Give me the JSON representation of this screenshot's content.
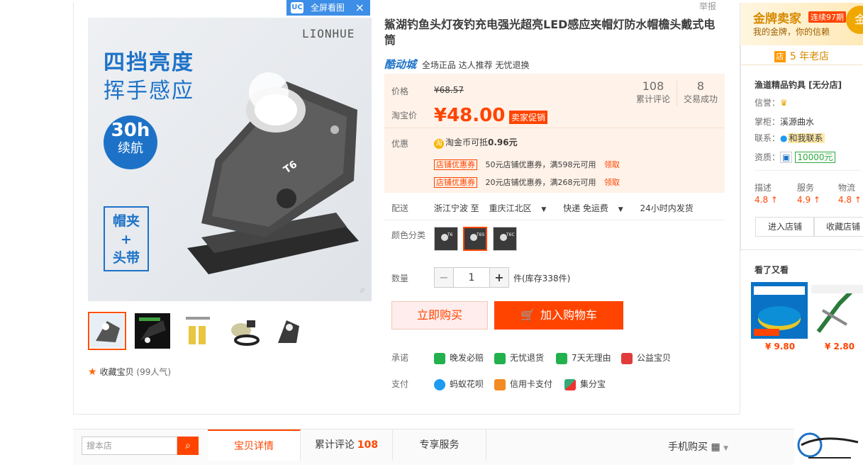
{
  "report_link": "举报",
  "fullscreen_tag": {
    "icon_text": "UC",
    "label": "全屏看图"
  },
  "gallery": {
    "brand": "LIONHUE",
    "headline1": "四挡亮度",
    "headline2": "挥手感应",
    "battery_big": "30h",
    "battery_small": "续航",
    "clip_text1": "帽夹",
    "clip_text2": "+",
    "clip_text3": "头带",
    "lamp_label": "T6"
  },
  "thumbnails_count": 5,
  "favorite": {
    "label": "收藏宝贝",
    "count": "(99人气)"
  },
  "product": {
    "title": "鯊湖钓鱼头灯夜钓充电强光超亮LED感应夹帽灯防水帽檐头戴式电筒",
    "store_brand": "酷动城",
    "tags": "全场正品 达人推荐 无忧退换"
  },
  "price": {
    "orig_label": "价格",
    "orig_value": "¥68.57",
    "cur_label": "淘宝价",
    "cur_value": "¥48.00",
    "promo": "卖家促销",
    "reviews_num": "108",
    "reviews_label": "累计评论",
    "sales_num": "8",
    "sales_label": "交易成功",
    "discount_label": "优惠",
    "coin_icon": "淘",
    "coin_text": "淘金币可抵",
    "coin_value": "0.96元",
    "coupons": [
      {
        "tag": "店铺优惠券",
        "text": "50元店铺优惠券，满598元可用",
        "action": "领取"
      },
      {
        "tag": "店铺优惠券",
        "text": "20元店铺优惠券，满268元可用",
        "action": "领取"
      }
    ]
  },
  "delivery": {
    "label": "配送",
    "from": "浙江宁波 至",
    "to": "重庆江北区",
    "method": "快递 免运费",
    "time": "24小时内发货"
  },
  "color": {
    "label": "颜色分类",
    "options": [
      "T6",
      "T6S",
      "T6C"
    ]
  },
  "quantity": {
    "label": "数量",
    "minus": "−",
    "value": "1",
    "plus": "+",
    "stock": "件(库存338件)"
  },
  "actions": {
    "buy": "立即购买",
    "cart": "加入购物车"
  },
  "promise": {
    "label": "承诺",
    "items": [
      "晚发必赔",
      "无忧退货",
      "7天无理由",
      "公益宝贝"
    ],
    "pay_label": "支付",
    "pay_items": [
      "蚂蚁花呗",
      "信用卡支付",
      "集分宝"
    ]
  },
  "seller": {
    "gold_title": "金牌卖家",
    "gold_badge": "连续97期",
    "gold_sub": "我的金牌，你的信赖",
    "gold_circle": "金",
    "years_icon": "店",
    "years": "5 年老店",
    "shop_name": "渔道精品钓具 [无分店]",
    "credit_label": "信誉：",
    "keeper_label": "掌柜：",
    "keeper": "溪源曲水",
    "contact_label": "联系：",
    "contact": "和我联系",
    "qual_label": "资质：",
    "deposit": "10000元",
    "scores": [
      {
        "name": "描述",
        "value": "4.8 ↑"
      },
      {
        "name": "服务",
        "value": "4.9 ↑"
      },
      {
        "name": "物流",
        "value": "4.8 ↑"
      }
    ],
    "enter_shop": "进入店铺",
    "fav_shop": "收藏店铺"
  },
  "see_also": {
    "title": "看了又看",
    "items": [
      {
        "price": "¥ 9.80"
      },
      {
        "price": "¥ 2.80"
      }
    ]
  },
  "bottom": {
    "search_placeholder": "搜本店",
    "tabs": [
      {
        "label": "宝贝详情"
      },
      {
        "label": "累计评论",
        "count": "108"
      },
      {
        "label": "专享服务"
      }
    ],
    "mobile_buy": "手机购买"
  },
  "colors": {
    "accent": "#ff4400",
    "blue": "#1d72c8",
    "gold": "#d68a00"
  }
}
